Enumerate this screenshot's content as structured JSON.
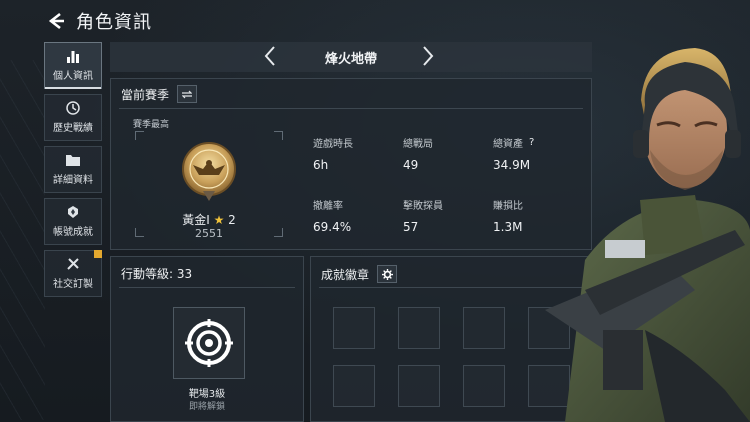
{
  "header": {
    "title": "角色資訊",
    "back_icon": "back-arrow-icon"
  },
  "sidebar": {
    "items": [
      {
        "label": "個人資訊",
        "icon": "bar-chart-icon",
        "active": true
      },
      {
        "label": "歷史戰績",
        "icon": "history-badge-icon",
        "active": false
      },
      {
        "label": "詳細資料",
        "icon": "folder-icon",
        "active": false
      },
      {
        "label": "帳號成就",
        "icon": "achievement-icon",
        "active": false
      },
      {
        "label": "社交訂製",
        "icon": "tools-icon",
        "active": false,
        "badge": true
      }
    ]
  },
  "mode": {
    "name": "烽火地帶"
  },
  "season": {
    "title": "當前賽季",
    "best_label": "賽季最高",
    "rank_name": "黃金I",
    "rank_stars": "2",
    "rank_score": "2551",
    "stats": [
      {
        "label": "遊戲時長",
        "value": "6h"
      },
      {
        "label": "總戰局",
        "value": "49"
      },
      {
        "label": "總資產",
        "value": "34.9M",
        "help": "?"
      },
      {
        "label": "撤離率",
        "value": "69.4%"
      },
      {
        "label": "擊敗探員",
        "value": "57"
      },
      {
        "label": "賺損比",
        "value": "1.3M"
      }
    ]
  },
  "level": {
    "title": "行動等級: 33",
    "target_name": "靶場3級",
    "target_status": "即將解鎖"
  },
  "badges": {
    "title": "成就徽章",
    "slots": 8
  },
  "colors": {
    "gold": "#f0c23a",
    "badge_alert": "#e3a82f"
  }
}
